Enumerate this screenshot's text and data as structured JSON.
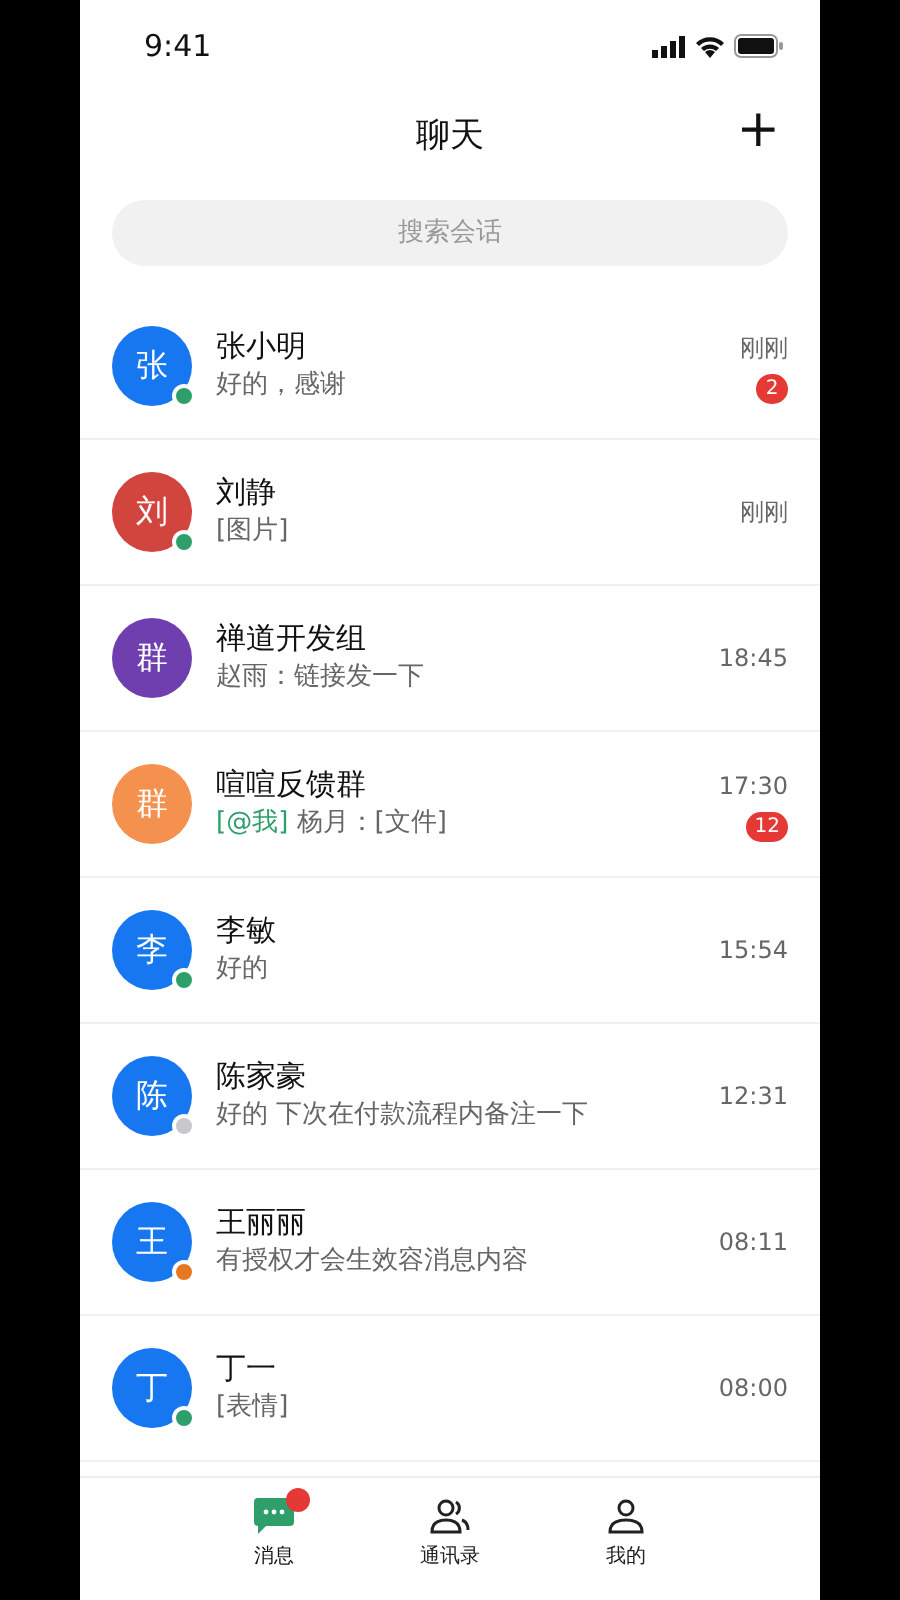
{
  "status_bar": {
    "time": "9:41"
  },
  "header": {
    "title": "聊天",
    "add_button": "+"
  },
  "search": {
    "placeholder": "搜索会话"
  },
  "chats": [
    {
      "avatar": {
        "text": "张",
        "color": "#1677f0"
      },
      "status": {
        "color": "#2e9e6a"
      },
      "name": "张小明",
      "preview": "好的，感谢",
      "time": "刚刚",
      "unread": "2"
    },
    {
      "avatar": {
        "text": "刘",
        "color": "#d2453f"
      },
      "status": {
        "color": "#2e9e6a"
      },
      "name": "刘静",
      "preview": "[图片]",
      "time": "刚刚"
    },
    {
      "avatar": {
        "text": "群",
        "color": "#6f3fb0"
      },
      "name": "禅道开发组",
      "preview": "赵雨：链接发一下",
      "time": "18:45"
    },
    {
      "avatar": {
        "text": "群",
        "color": "#f5914e"
      },
      "name": "喧喧反馈群",
      "mention": "[@我]",
      "preview": "杨月：[文件]",
      "time": "17:30",
      "unread": "12"
    },
    {
      "avatar": {
        "text": "李",
        "color": "#1677f0"
      },
      "status": {
        "color": "#2e9e6a"
      },
      "name": "李敏",
      "preview": "好的",
      "time": "15:54"
    },
    {
      "avatar": {
        "text": "陈",
        "color": "#1677f0"
      },
      "status": {
        "color": "#c8c8cc"
      },
      "name": "陈家豪",
      "preview": "好的 下次在付款流程内备注一下",
      "time": "12:31"
    },
    {
      "avatar": {
        "text": "王",
        "color": "#1677f0"
      },
      "status": {
        "color": "#e87722"
      },
      "name": "王丽丽",
      "preview": "有授权才会生效容消息内容",
      "time": "08:11"
    },
    {
      "avatar": {
        "text": "丁",
        "color": "#1677f0"
      },
      "status": {
        "color": "#2e9e6a"
      },
      "name": "丁一",
      "preview": "[表情]",
      "time": "08:00"
    }
  ],
  "tabs": [
    {
      "kind": "chat",
      "label": "消息",
      "selected": true,
      "badge": true
    },
    {
      "kind": "contacts",
      "label": "通讯录",
      "selected": false,
      "badge": false
    },
    {
      "kind": "me",
      "label": "我的",
      "selected": false,
      "badge": false
    }
  ]
}
